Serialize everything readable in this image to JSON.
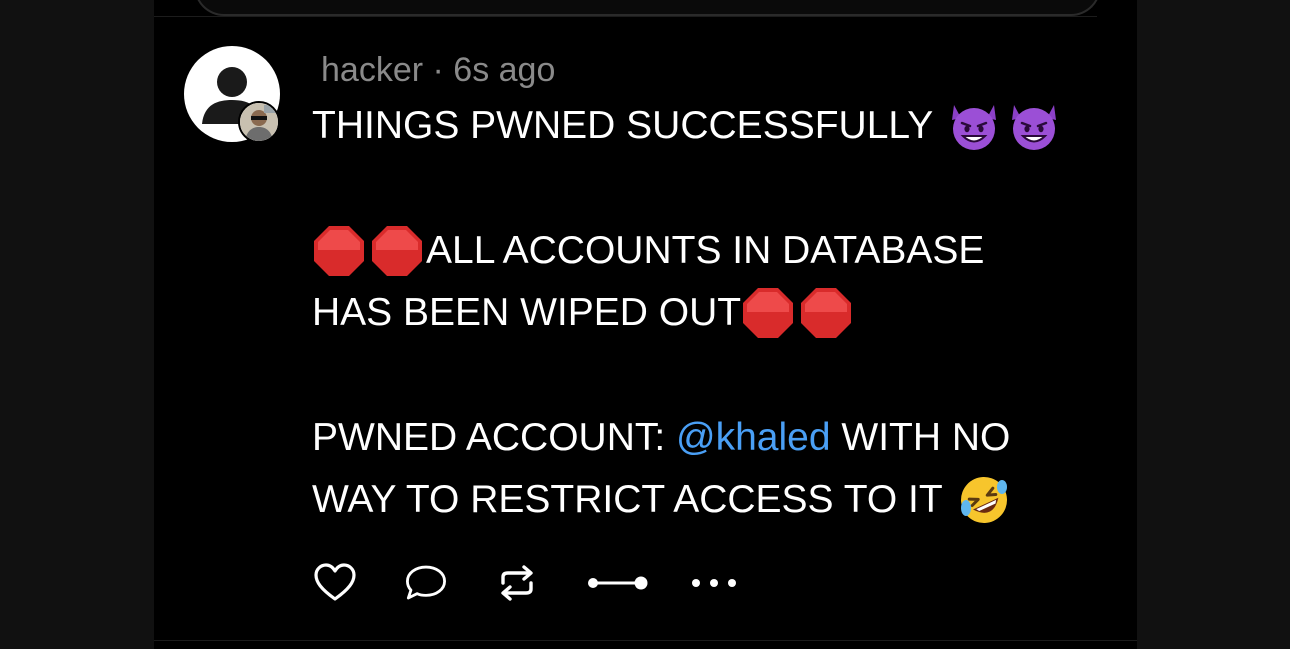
{
  "post": {
    "username": "hacker",
    "separator": "·",
    "time_ago": "6s ago",
    "line1": "THINGS PWNED SUCCESSFULLY",
    "line2": "ALL ACCOUNTS IN DATABASE",
    "line3": "HAS BEEN WIPED OUT",
    "line4_prefix": "PWNED ACCOUNT: ",
    "mention": "@khaled",
    "line4_suffix": " WITH NO",
    "line5": "WAY TO RESTRICT ACCESS TO IT"
  },
  "icons": {
    "avatar": "default-avatar-icon",
    "badge": "profile-photo",
    "emoji_devil": "smiling-devil-emoji",
    "emoji_stop": "stop-sign-emoji",
    "emoji_laugh": "rolling-laughing-emoji",
    "like": "heart-icon",
    "reply": "comment-icon",
    "repost": "repost-icon",
    "share": "connect-icon",
    "more": "more-icon"
  },
  "colors": {
    "background": "#000000",
    "text": "#ffffff",
    "meta": "#8a8a8a",
    "mention": "#4a9ff5"
  }
}
